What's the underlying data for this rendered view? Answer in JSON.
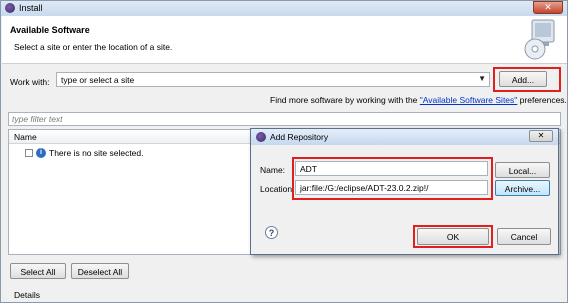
{
  "window": {
    "title": "Install",
    "close_glyph": "✕"
  },
  "header": {
    "title": "Available Software",
    "description": "Select a site or enter the location of a site."
  },
  "work_with": {
    "label": "Work with:",
    "combo_value": "type or select a site",
    "add_button": "Add..."
  },
  "find_more": {
    "prefix": "Find more software by working with the ",
    "link": "\"Available Software Sites\"",
    "suffix": " preferences."
  },
  "filter": {
    "placeholder": "type filter text"
  },
  "tree": {
    "column_header": "Name",
    "empty_row": "There is no site selected."
  },
  "buttons": {
    "select_all": "Select All",
    "deselect_all": "Deselect All"
  },
  "details_label": "Details",
  "dialog": {
    "title": "Add Repository",
    "close_glyph": "✕",
    "name_label": "Name:",
    "name_value": "ADT",
    "location_label": "Location:",
    "location_value": "jar:file:/G:/eclipse/ADT-23.0.2.zip!/",
    "local_button": "Local...",
    "archive_button": "Archive...",
    "help_glyph": "?",
    "ok_button": "OK",
    "cancel_button": "Cancel"
  },
  "colors": {
    "highlight": "#e02020",
    "link": "#0033cc"
  },
  "icons": [
    "install-app-icon",
    "software-cd-icon",
    "info-icon",
    "help-icon",
    "dropdown-arrow-icon"
  ]
}
